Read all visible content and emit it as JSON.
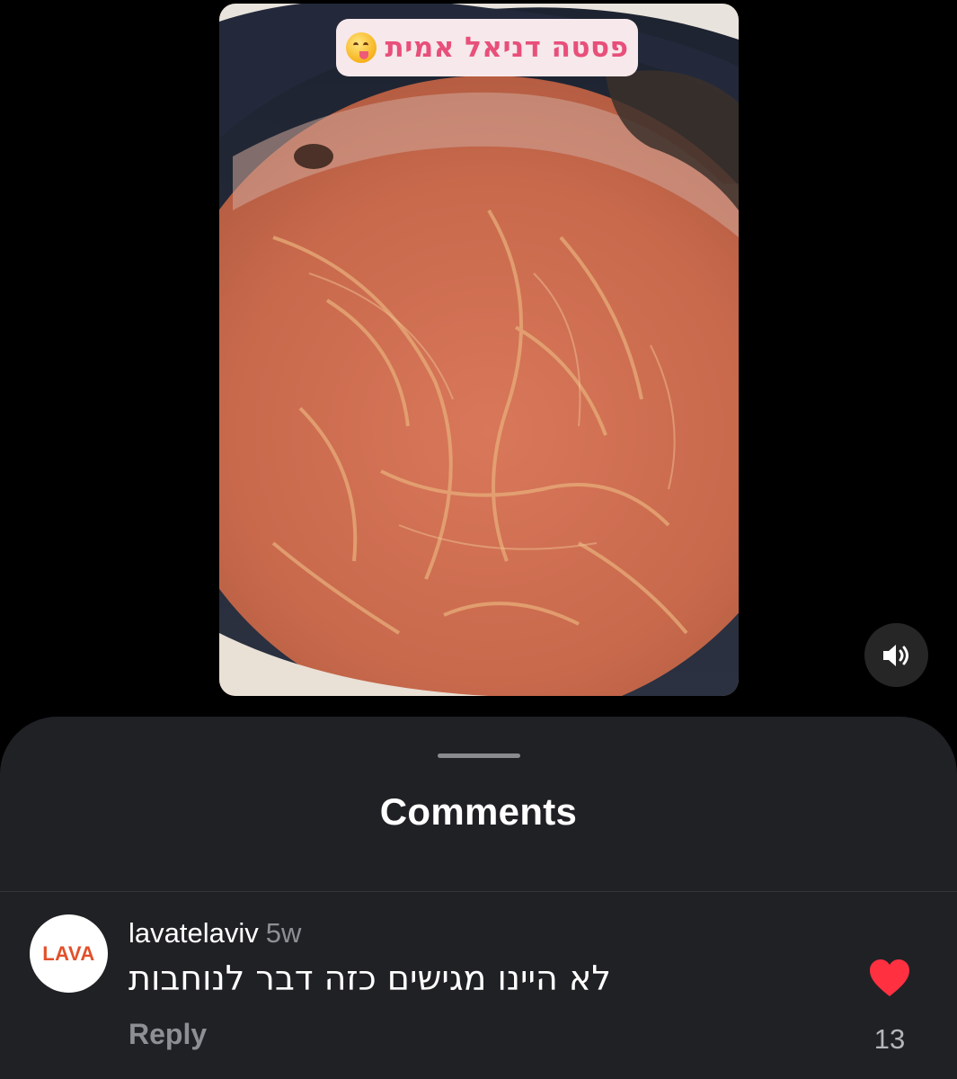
{
  "video": {
    "caption": "פסטה דניאל אמית",
    "caption_emoji": "face-savoring-food-icon",
    "sound_icon": "speaker-icon"
  },
  "comments_sheet": {
    "title": "Comments",
    "comments": [
      {
        "avatar_text": "LAVA",
        "username": "lavatelaviv",
        "timestamp": "5w",
        "text": "לא היינו מגישים כזה דבר לנוחבות",
        "reply_label": "Reply",
        "liked": true,
        "like_count": "13"
      }
    ]
  },
  "colors": {
    "background": "#000000",
    "sheet_background": "#202125",
    "caption_text": "#e84f7a",
    "like_heart": "#ff3040",
    "avatar_brand": "#e2502a",
    "secondary_text": "#8e8f94"
  }
}
